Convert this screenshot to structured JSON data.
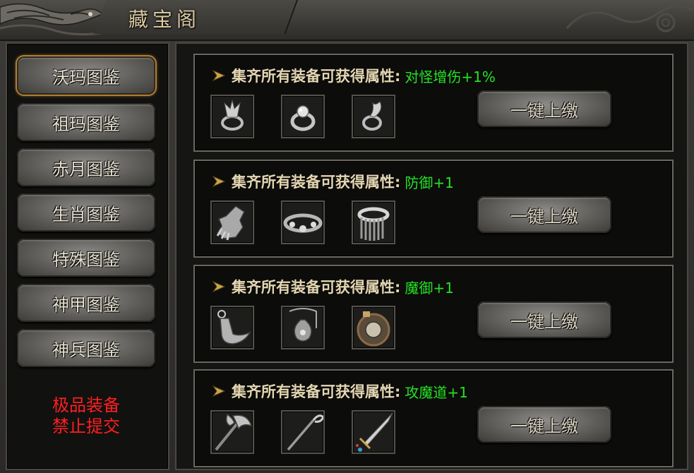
{
  "window": {
    "title": "藏宝阁"
  },
  "sidebar": {
    "items": [
      {
        "label": "沃玛图鉴",
        "active": true
      },
      {
        "label": "祖玛图鉴",
        "active": false
      },
      {
        "label": "赤月图鉴",
        "active": false
      },
      {
        "label": "生肖图鉴",
        "active": false
      },
      {
        "label": "特殊图鉴",
        "active": false
      },
      {
        "label": "神甲图鉴",
        "active": false
      },
      {
        "label": "神兵图鉴",
        "active": false
      }
    ],
    "note_line1": "极品装备",
    "note_line2": "禁止提交"
  },
  "cards": [
    {
      "label": "集齐所有装备可获得属性:",
      "attribute": "对怪增伤+1%",
      "button": "一键上缴",
      "items": [
        "ring-icon",
        "ring-icon",
        "ring-icon"
      ]
    },
    {
      "label": "集齐所有装备可获得属性:",
      "attribute": "防御+1",
      "button": "一键上缴",
      "items": [
        "glove-icon",
        "bracelet-icon",
        "bracer-icon"
      ]
    },
    {
      "label": "集齐所有装备可获得属性:",
      "attribute": "魔御+1",
      "button": "一键上缴",
      "items": [
        "boot-icon",
        "amulet-icon",
        "shield-icon"
      ]
    },
    {
      "label": "集齐所有装备可获得属性:",
      "attribute": "攻魔道+1",
      "button": "一键上缴",
      "items": [
        "axe-icon",
        "staff-icon",
        "sword-icon"
      ]
    }
  ],
  "colors": {
    "accent_green": "#23e323",
    "warning_red": "#ff1f1f",
    "active_border": "#b47d2a"
  }
}
